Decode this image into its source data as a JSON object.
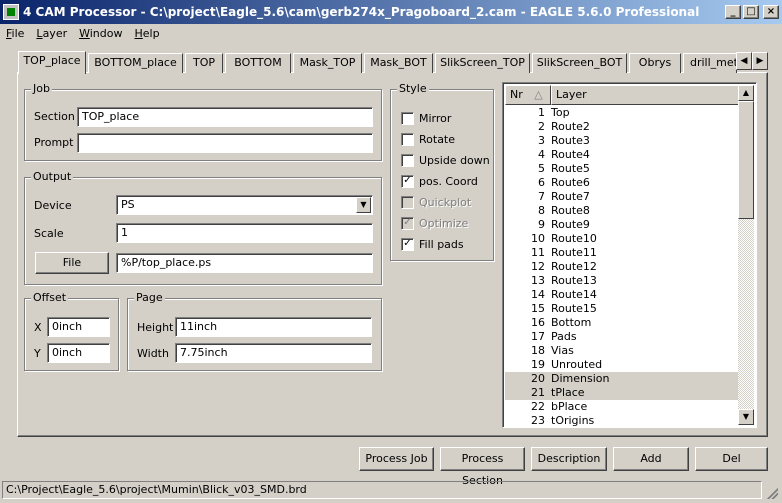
{
  "window": {
    "title": "4 CAM Processor - C:\\project\\Eagle_5.6\\cam\\gerb274x_Pragoboard_2.cam - EAGLE 5.6.0 Professional",
    "min_glyph": "_",
    "max_glyph": "□",
    "close_glyph": "×"
  },
  "menu": [
    "File",
    "Layer",
    "Window",
    "Help"
  ],
  "tabs": [
    "TOP_place",
    "BOTTOM_place",
    "TOP",
    "BOTTOM",
    "Mask_TOP",
    "Mask_BOT",
    "SlikScreen_TOP",
    "SlikScreen_BOT",
    "Obrys",
    "drill_metal"
  ],
  "active_tab": 0,
  "tab_scroll": {
    "left": "◀",
    "right": "▶"
  },
  "job": {
    "title": "Job",
    "section_label": "Section",
    "section_value": "TOP_place",
    "prompt_label": "Prompt",
    "prompt_value": ""
  },
  "output": {
    "title": "Output",
    "device_label": "Device",
    "device_value": "PS",
    "scale_label": "Scale",
    "scale_value": "1",
    "file_button": "File",
    "file_value": "%P/top_place.ps"
  },
  "offset": {
    "title": "Offset",
    "x_label": "X",
    "x_value": "0inch",
    "y_label": "Y",
    "y_value": "0inch"
  },
  "page": {
    "title": "Page",
    "height_label": "Height",
    "height_value": "11inch",
    "width_label": "Width",
    "width_value": "7.75inch"
  },
  "style": {
    "title": "Style",
    "options": [
      {
        "label": "Mirror",
        "checked": false,
        "disabled": false
      },
      {
        "label": "Rotate",
        "checked": false,
        "disabled": false
      },
      {
        "label": "Upside down",
        "checked": false,
        "disabled": false
      },
      {
        "label": "pos. Coord",
        "checked": true,
        "disabled": false
      },
      {
        "label": "Quickplot",
        "checked": false,
        "disabled": true
      },
      {
        "label": "Optimize",
        "checked": true,
        "disabled": true
      },
      {
        "label": "Fill pads",
        "checked": true,
        "disabled": false
      }
    ]
  },
  "layers": {
    "col_nr": "Nr",
    "col_layer": "Layer",
    "rows": [
      {
        "nr": "1",
        "name": "Top",
        "selected": false
      },
      {
        "nr": "2",
        "name": "Route2",
        "selected": false
      },
      {
        "nr": "3",
        "name": "Route3",
        "selected": false
      },
      {
        "nr": "4",
        "name": "Route4",
        "selected": false
      },
      {
        "nr": "5",
        "name": "Route5",
        "selected": false
      },
      {
        "nr": "6",
        "name": "Route6",
        "selected": false
      },
      {
        "nr": "7",
        "name": "Route7",
        "selected": false
      },
      {
        "nr": "8",
        "name": "Route8",
        "selected": false
      },
      {
        "nr": "9",
        "name": "Route9",
        "selected": false
      },
      {
        "nr": "10",
        "name": "Route10",
        "selected": false
      },
      {
        "nr": "11",
        "name": "Route11",
        "selected": false
      },
      {
        "nr": "12",
        "name": "Route12",
        "selected": false
      },
      {
        "nr": "13",
        "name": "Route13",
        "selected": false
      },
      {
        "nr": "14",
        "name": "Route14",
        "selected": false
      },
      {
        "nr": "15",
        "name": "Route15",
        "selected": false
      },
      {
        "nr": "16",
        "name": "Bottom",
        "selected": false
      },
      {
        "nr": "17",
        "name": "Pads",
        "selected": false
      },
      {
        "nr": "18",
        "name": "Vias",
        "selected": false
      },
      {
        "nr": "19",
        "name": "Unrouted",
        "selected": false
      },
      {
        "nr": "20",
        "name": "Dimension",
        "selected": true
      },
      {
        "nr": "21",
        "name": "tPlace",
        "selected": true
      },
      {
        "nr": "22",
        "name": "bPlace",
        "selected": false
      },
      {
        "nr": "23",
        "name": "tOrigins",
        "selected": false
      }
    ]
  },
  "buttons": {
    "process_job": "Process Job",
    "process_section": "Process Section",
    "description": "Description",
    "add": "Add",
    "del": "Del"
  },
  "status": "C:\\Project\\Eagle_5.6\\project\\Mumin\\Blick_v03_SMD.brd"
}
